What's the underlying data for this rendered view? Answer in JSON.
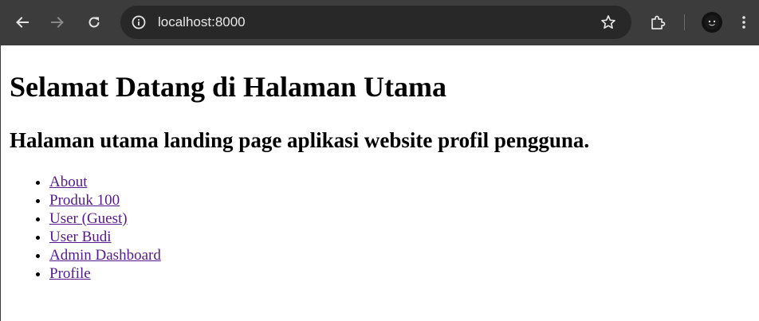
{
  "browser": {
    "url": "localhost:8000",
    "colors": {
      "toolbar": "#3c3c3c",
      "omnibox": "#282828",
      "url_text": "#e8e8e8",
      "icon_active": "#e3e3e3",
      "icon_disabled": "#8a8a8a"
    },
    "icons": {
      "back": "arrow-left-icon",
      "forward": "arrow-right-icon",
      "reload": "reload-icon",
      "site_info": "info-circle-icon",
      "bookmark": "star-outline-icon",
      "extensions": "puzzle-icon",
      "profile": "avatar-icon",
      "menu": "three-dots-vertical-icon"
    }
  },
  "page": {
    "heading": "Selamat Datang di Halaman Utama",
    "subheading": "Halaman utama landing page aplikasi website profil pengguna.",
    "link_color": "#551a8b",
    "links": [
      {
        "label": "About"
      },
      {
        "label": "Produk 100"
      },
      {
        "label": "User (Guest)"
      },
      {
        "label": "User Budi"
      },
      {
        "label": "Admin Dashboard"
      },
      {
        "label": "Profile"
      }
    ]
  }
}
